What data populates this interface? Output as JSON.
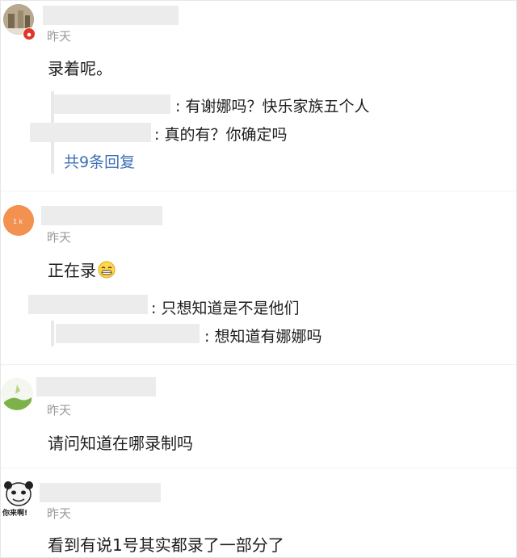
{
  "comments": [
    {
      "time": "昨天",
      "text": "录着呢。",
      "replies": [
        {
          "text": ": 有谢娜吗？快乐家族五个人"
        },
        {
          "text": ": 真的有？你确定吗"
        }
      ],
      "more_replies": "共9条回复"
    },
    {
      "time": "昨天",
      "text": "正在录",
      "emoji": "grin-emoji",
      "replies": [
        {
          "text": ": 只想知道是不是他们"
        },
        {
          "text": ": 想知道有娜娜吗"
        }
      ]
    },
    {
      "time": "昨天",
      "text": "请问知道在哪录制吗"
    },
    {
      "time": "昨天",
      "text": "看到有说1号其实都录了一部分了",
      "avatar_caption": "你来啊!"
    }
  ],
  "colors": {
    "link": "#3d6fb6",
    "time": "#9a9a9a",
    "badge": "#e0352b"
  }
}
